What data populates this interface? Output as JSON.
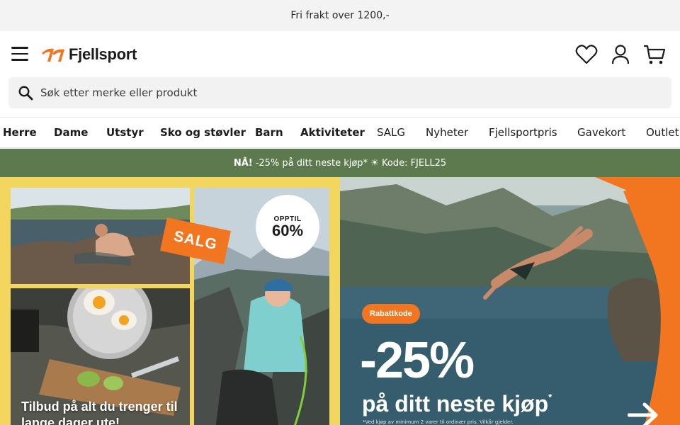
{
  "topbar": {
    "text": "Fri frakt over 1200,-"
  },
  "header": {
    "brand": "Fjellsport",
    "icons": [
      "menu-icon",
      "heart-icon",
      "user-icon",
      "cart-icon"
    ]
  },
  "search": {
    "placeholder": "Søk etter merke eller produkt"
  },
  "nav": {
    "items": [
      {
        "label": "Herre"
      },
      {
        "label": "Dame"
      },
      {
        "label": "Utstyr"
      },
      {
        "label": "Sko og støvler"
      },
      {
        "label": "Barn"
      },
      {
        "label": "Aktiviteter"
      },
      {
        "label": "SALG"
      },
      {
        "label": "Nyheter"
      },
      {
        "label": "Fjellsportpris"
      },
      {
        "label": "Gavekort"
      },
      {
        "label": "Outlet"
      }
    ]
  },
  "promo": {
    "prefix": "NÅ!",
    "text": "-25% på ditt neste kjøp* ☀ Kode: FJELL25"
  },
  "hero_left": {
    "salg_badge": "SALG",
    "opptil_top": "OPPTIL",
    "opptil_value": "60%",
    "headline": "Tilbud på alt du trenger til lange dager ute!"
  },
  "hero_right": {
    "pill": "Rabattkode",
    "big": "-25%",
    "sub": "på ditt neste kjøp",
    "sub_mark": "*",
    "fineprint": "*Ved kjøp av minimum 2 varer til ordinær pris. Vilkår gjelder."
  },
  "colors": {
    "accent_orange": "#f2761f",
    "promo_green": "#5d7a4e",
    "hero_yellow": "#f2d65e"
  }
}
